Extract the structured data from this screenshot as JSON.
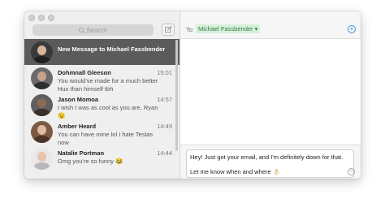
{
  "sidebar": {
    "search_placeholder": "Search",
    "conversations": [
      {
        "name": "New Message to Michael Fassbender",
        "time": "",
        "preview": "",
        "active": true
      },
      {
        "name": "Dohmnall Gleeson",
        "time": "15:01",
        "preview": "You would've made for a much better Hux than himself tbh"
      },
      {
        "name": "Jason Momoa",
        "time": "14:57",
        "preview": "I wish I was as cool as you are, Ryan 😉"
      },
      {
        "name": "Amber Heard",
        "time": "14:49",
        "preview": "You can have mine lol I hate Teslas now"
      },
      {
        "name": "Natalie Portman",
        "time": "14:44",
        "preview": "Omg you're so funny 😂"
      }
    ]
  },
  "header": {
    "to_label": "To:",
    "recipient": "Michael Fassbender"
  },
  "composer": {
    "line1": "Hey! Just got your email, and I'm definitely down for that.",
    "line2": "Let me know when and where 👌🏻"
  },
  "colors": {
    "active_row": "#5b5b5b",
    "recipient_bg": "#d6f0dc",
    "accent_blue": "#3b8fe0"
  }
}
